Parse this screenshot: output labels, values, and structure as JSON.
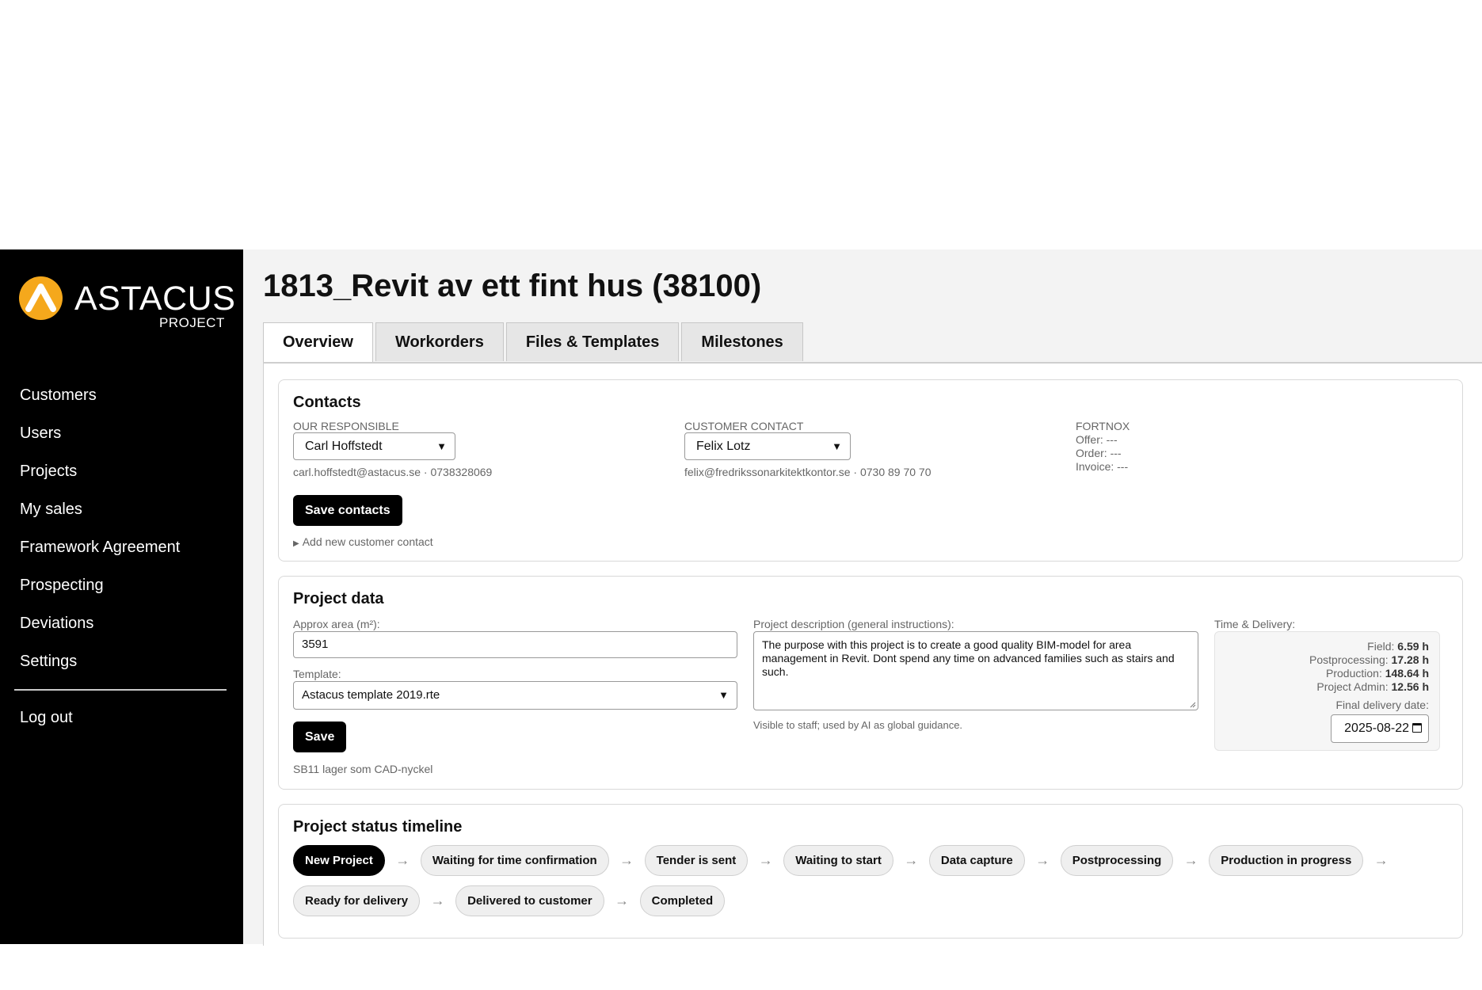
{
  "sidebar": {
    "logo": {
      "word": "ASTACUS",
      "sub": "PROJECT",
      "icon": "astacus-logo-icon",
      "accent": "#f5a81c"
    },
    "items": [
      {
        "label": "Customers"
      },
      {
        "label": "Users"
      },
      {
        "label": "Projects"
      },
      {
        "label": "My sales"
      },
      {
        "label": "Framework Agreement"
      },
      {
        "label": "Prospecting"
      },
      {
        "label": "Deviations"
      },
      {
        "label": "Settings"
      }
    ],
    "logout": "Log out"
  },
  "page": {
    "title": "1813_Revit av ett fint hus (38100)"
  },
  "tabs": [
    "Overview",
    "Workorders",
    "Files & Templates",
    "Milestones"
  ],
  "contacts": {
    "title": "Contacts",
    "our_responsible_label": "OUR RESPONSIBLE",
    "our_responsible_value": "Carl Hoffstedt",
    "our_responsible_meta": "carl.hoffstedt@astacus.se · 0738328069",
    "customer_contact_label": "CUSTOMER CONTACT",
    "customer_contact_value": "Felix Lotz",
    "customer_contact_meta": "felix@fredrikssonarkitektkontor.se · 0730 89 70 70",
    "fortnox_label": "FORTNOX",
    "fortnox_offer": "Offer: ---",
    "fortnox_order": "Order: ---",
    "fortnox_invoice": "Invoice: ---",
    "save_label": "Save contacts",
    "add_contact": "Add new customer contact"
  },
  "project_data": {
    "title": "Project data",
    "area_label": "Approx area (m²):",
    "area_value": "3591",
    "template_label": "Template:",
    "template_value": "Astacus template 2019.rte",
    "save_label": "Save",
    "note": "SB11 lager som CAD-nyckel",
    "description_label": "Project description (general instructions):",
    "description_value": "The purpose with this project is to create a good quality BIM-model for area management in Revit. Dont spend any time on advanced families such as stairs and such.",
    "description_hint": "Visible to staff; used by AI as global guidance.",
    "time_label": "Time & Delivery:",
    "time": {
      "field_label": "Field:",
      "field_value": "6.59 h",
      "post_label": "Postprocessing:",
      "post_value": "17.28 h",
      "prod_label": "Production:",
      "prod_value": "148.64 h",
      "admin_label": "Project Admin:",
      "admin_value": "12.56 h"
    },
    "final_delivery_label": "Final delivery date:",
    "final_delivery_value": "2025-08-22"
  },
  "timeline": {
    "title": "Project status timeline",
    "arrow": "→",
    "active_index": 0,
    "row1": [
      "New Project",
      "Waiting for time confirmation",
      "Tender is sent",
      "Waiting to start",
      "Data capture",
      "Postprocessing",
      "Production in progress"
    ],
    "row2": [
      "Ready for delivery",
      "Delivered to customer",
      "Completed"
    ]
  }
}
